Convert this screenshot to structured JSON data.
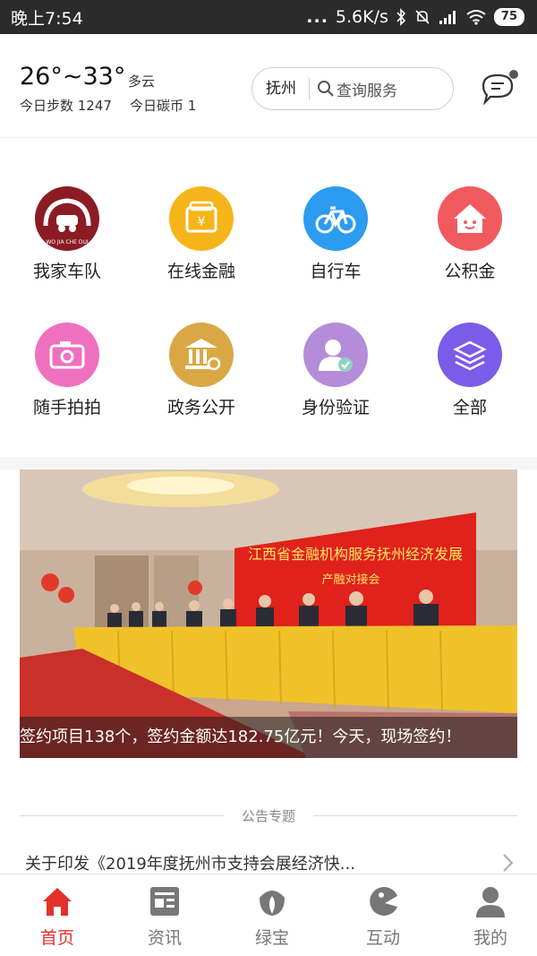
{
  "status_bar": {
    "time": "晚上7:54",
    "dots": "...",
    "speed": "5.6K/s",
    "battery": "75"
  },
  "header": {
    "temperature": "26°~33°",
    "weather": "多云",
    "steps": "今日步数 1247",
    "carbon": "今日碳币 1",
    "city": "抚州",
    "search_placeholder": "查询服务",
    "message_icon": "chat-bubble-icon"
  },
  "grid": {
    "items": [
      {
        "label": "我家车队",
        "icon": "car-team-icon",
        "color": "#8b1c24",
        "sub": "WO JIA CHE DUI"
      },
      {
        "label": "在线金融",
        "icon": "finance-icon",
        "color": "#f5b51a"
      },
      {
        "label": "自行车",
        "icon": "bicycle-icon",
        "color": "#2c9cf0"
      },
      {
        "label": "公积金",
        "icon": "house-fund-icon",
        "color": "#f05a5f"
      },
      {
        "label": "随手拍拍",
        "icon": "camera-icon",
        "color": "#f070c0"
      },
      {
        "label": "政务公开",
        "icon": "government-icon",
        "color": "#d9a845"
      },
      {
        "label": "身份验证",
        "icon": "identity-verify-icon",
        "color": "#b58cd9"
      },
      {
        "label": "全部",
        "icon": "layers-icon",
        "color": "#7b5ce8"
      }
    ]
  },
  "banner": {
    "stage_title": "江西省金融机构服务抚州经济发展",
    "stage_subtitle": "产融对接会",
    "caption": "签约项目138个，签约金额达182.75亿元！今天，现场签约！"
  },
  "notice": {
    "section_title": "公告专题",
    "item": "关于印发《2019年度抚州市支持会展经济快..."
  },
  "tabbar": {
    "tabs": [
      {
        "label": "首页",
        "icon": "home-icon",
        "active": true
      },
      {
        "label": "资讯",
        "icon": "news-icon"
      },
      {
        "label": "绿宝",
        "icon": "leaf-icon"
      },
      {
        "label": "互动",
        "icon": "interact-icon"
      },
      {
        "label": "我的",
        "icon": "user-icon"
      }
    ]
  },
  "colors": {
    "accent": "#e3302a",
    "status_bar": "#2b2b2b",
    "inactive_tab": "#777777"
  }
}
